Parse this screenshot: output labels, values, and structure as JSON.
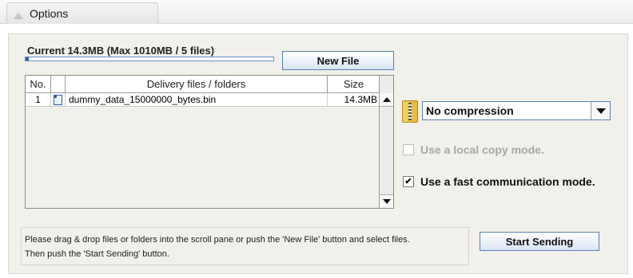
{
  "header": {
    "tab_label": "Options"
  },
  "upload": {
    "current_label": "Current 14.3MB (Max 1010MB / 5 files)",
    "progress_percent": 1.4,
    "new_file_label": "New File"
  },
  "table": {
    "columns": [
      "No.",
      "",
      "Delivery files / folders",
      "Size"
    ],
    "rows": [
      {
        "no": "1",
        "name": "dummy_data_15000000_bytes.bin",
        "size": "14.3MB"
      }
    ]
  },
  "compression": {
    "selected": "No compression"
  },
  "options": {
    "local_copy_label": "Use a local copy mode.",
    "local_copy_checked": false,
    "local_copy_enabled": false,
    "fast_comm_label": "Use a fast communication mode.",
    "fast_comm_checked": true,
    "checkmark": "✔"
  },
  "footer": {
    "instruction_line1": "Please drag & drop files or folders into the scroll pane or push the 'New File' button and select files.",
    "instruction_line2": "Then push the 'Start Sending' button.",
    "send_label": "Start Sending"
  },
  "colors": {
    "panel_bg": "#f1f0ea",
    "button_border": "#5b7fb0",
    "progress_fill": "#2f5ea8"
  }
}
